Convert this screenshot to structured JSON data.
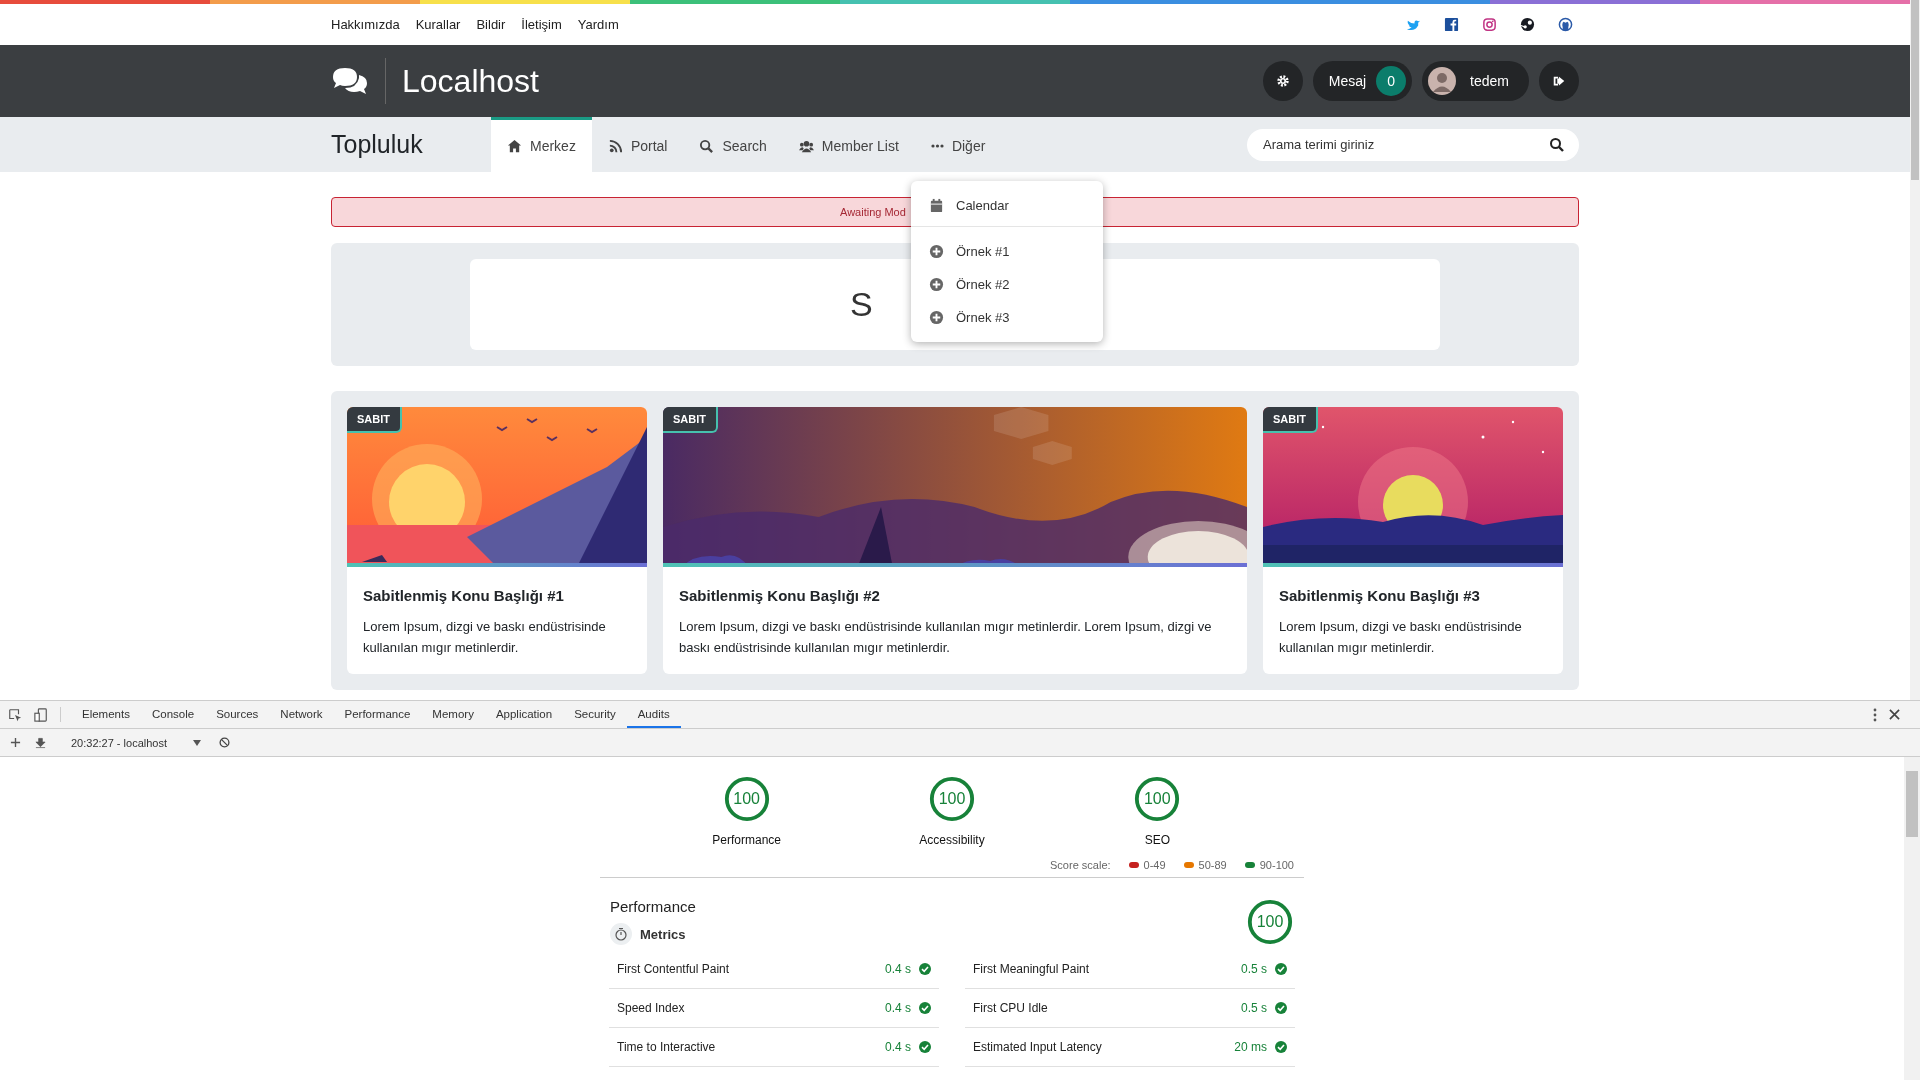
{
  "top_links": [
    "Hakkımızda",
    "Kurallar",
    "Bildir",
    "İletişim",
    "Yardım"
  ],
  "header": {
    "site_name": "Localhost",
    "message_label": "Mesaj",
    "message_count": "0",
    "username": "tedem"
  },
  "nav": {
    "title": "Topluluk",
    "search": {
      "placeholder": "Arama terimi giriniz"
    },
    "tabs": [
      {
        "label": "Merkez",
        "selected": true
      },
      {
        "label": "Portal",
        "selected": false
      },
      {
        "label": "Search",
        "selected": false
      },
      {
        "label": "Member List",
        "selected": false
      },
      {
        "label": "Diğer",
        "selected": false
      }
    ]
  },
  "dropdown": {
    "items": [
      {
        "label": "Calendar"
      },
      {
        "label": "Örnek #1"
      },
      {
        "label": "Örnek #2"
      },
      {
        "label": "Örnek #3"
      }
    ]
  },
  "alert": {
    "text": "Awaiting Mod"
  },
  "banner": {
    "text": "S"
  },
  "pinned": [
    {
      "badge": "SABIT",
      "title": "Sabitlenmiş Konu Başlığı #1",
      "text": "Lorem Ipsum, dizgi ve baskı endüstrisinde kullanılan mıgır metinlerdir."
    },
    {
      "badge": "SABIT",
      "title": "Sabitlenmiş Konu Başlığı #2",
      "text": "Lorem Ipsum, dizgi ve baskı endüstrisinde kullanılan mıgır metinlerdir. Lorem Ipsum, dizgi ve baskı endüstrisinde kullanılan mıgır metinlerdir."
    },
    {
      "badge": "SABIT",
      "title": "Sabitlenmiş Konu Başlığı #3",
      "text": "Lorem Ipsum, dizgi ve baskı endüstrisinde kullanılan mıgır metinlerdir."
    }
  ],
  "devtools": {
    "tabs": [
      {
        "label": "Elements",
        "selected": false
      },
      {
        "label": "Console",
        "selected": false
      },
      {
        "label": "Sources",
        "selected": false
      },
      {
        "label": "Network",
        "selected": false
      },
      {
        "label": "Performance",
        "selected": false
      },
      {
        "label": "Memory",
        "selected": false
      },
      {
        "label": "Application",
        "selected": false
      },
      {
        "label": "Security",
        "selected": false
      },
      {
        "label": "Audits",
        "selected": true
      }
    ],
    "session": "20:32:27 - localhost",
    "scores": [
      {
        "value": "100",
        "label": "Performance",
        "level": 1
      },
      {
        "value": "100",
        "label": "Accessibility",
        "level": 1
      },
      {
        "value": "100",
        "label": "SEO",
        "level": 1
      }
    ],
    "scale": {
      "label": "Score scale:",
      "ranges": [
        {
          "label": "0-49",
          "color": "#c5221f"
        },
        {
          "label": "50-89",
          "color": "#e67700"
        },
        {
          "label": "90-100",
          "color": "#178239"
        }
      ]
    },
    "performance": {
      "title": "Performance",
      "score": "100",
      "level": 1,
      "metrics_title": "Metrics",
      "metrics": [
        {
          "label": "First Contentful Paint",
          "value": "0.4 s"
        },
        {
          "label": "First Meaningful Paint",
          "value": "0.5 s"
        },
        {
          "label": "Speed Index",
          "value": "0.4 s"
        },
        {
          "label": "First CPU Idle",
          "value": "0.5 s"
        },
        {
          "label": "Time to Interactive",
          "value": "0.4 s"
        },
        {
          "label": "Estimated Input Latency",
          "value": "20 ms"
        }
      ]
    }
  }
}
